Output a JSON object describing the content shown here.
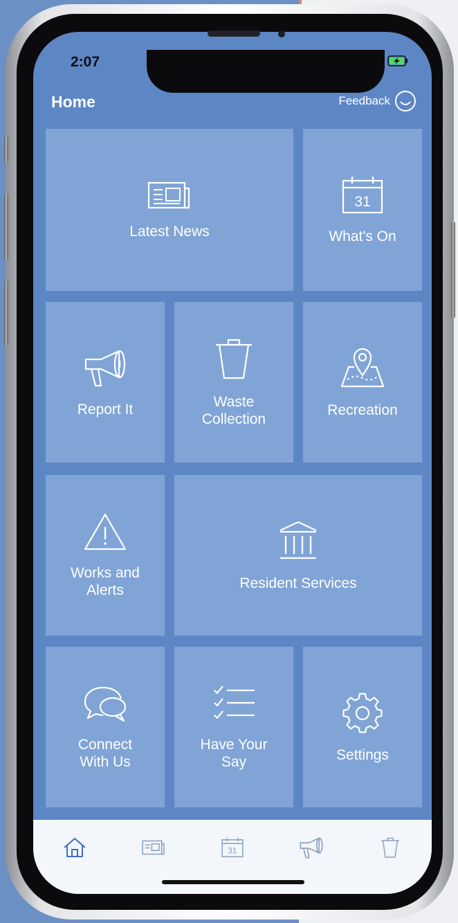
{
  "status_bar": {
    "time": "2:07"
  },
  "header": {
    "title": "Home",
    "feedback_label": "Feedback"
  },
  "tiles": [
    {
      "label": "Latest News",
      "icon": "newspaper-icon"
    },
    {
      "label": "What's On",
      "icon": "calendar-icon"
    },
    {
      "label": "Report It",
      "icon": "megaphone-icon"
    },
    {
      "label": "Waste\nCollection",
      "icon": "trash-bin-icon"
    },
    {
      "label": "Recreation",
      "icon": "map-pin-icon"
    },
    {
      "label": "Works and\nAlerts",
      "icon": "warning-icon"
    },
    {
      "label": "Resident Services",
      "icon": "building-columns-icon"
    },
    {
      "label": "Connect\nWith Us",
      "icon": "chat-bubbles-icon"
    },
    {
      "label": "Have Your\nSay",
      "icon": "checklist-icon"
    },
    {
      "label": "Settings",
      "icon": "gear-icon"
    }
  ],
  "calendar_day": "31",
  "tabbar": {
    "items": [
      {
        "icon": "home-icon",
        "active": true
      },
      {
        "icon": "newspaper-icon",
        "active": false
      },
      {
        "icon": "calendar-icon",
        "active": false
      },
      {
        "icon": "megaphone-icon",
        "active": false
      },
      {
        "icon": "trash-bin-icon",
        "active": false
      }
    ]
  },
  "colors": {
    "screen_bg": "#5d86c5",
    "tile_bg": "#80a4d6",
    "tabbar_bg": "#f3f6fa",
    "tab_icon": "#8ea3c0",
    "tab_active": "#3f6fb7"
  }
}
